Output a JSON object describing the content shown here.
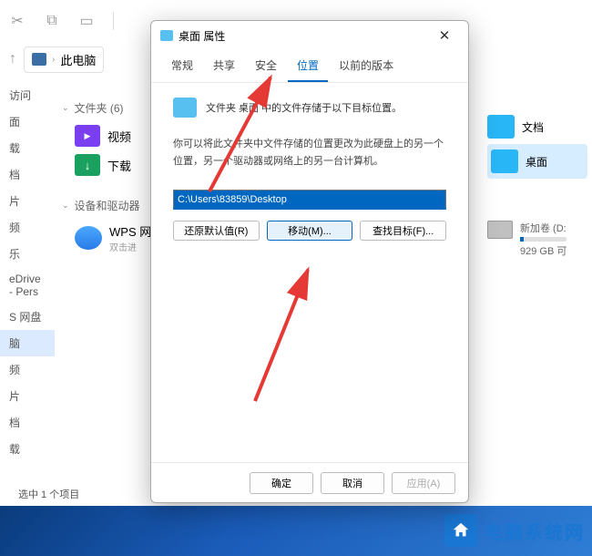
{
  "explorer": {
    "address_label": "此电脑",
    "sidebar_items": [
      "访问",
      "面",
      "载",
      "档",
      "片",
      "频",
      "乐",
      "eDrive - Pers",
      "S 网盘",
      "脑",
      "频",
      "片",
      "档",
      "载"
    ],
    "section_folders": "文件夹 (6)",
    "folder1": "视频",
    "folder2": "下载",
    "section_devices": "设备和驱动器",
    "device1": "WPS 网",
    "device1_sub": "双击进",
    "right_item1": "文档",
    "right_item2": "桌面",
    "drive_label": "新加卷 (D:",
    "drive_free": "929 GB 可",
    "status": "选中 1 个项目"
  },
  "dialog": {
    "title": "桌面 属性",
    "tabs": [
      "常规",
      "共享",
      "安全",
      "位置",
      "以前的版本"
    ],
    "active_tab_index": 3,
    "desc1": "文件夹 桌面 中的文件存储于以下目标位置。",
    "desc2": "你可以将此文件夹中文件存储的位置更改为此硬盘上的另一个位置，另一个驱动器或网络上的另一台计算机。",
    "path": "C:\\Users\\83859\\Desktop",
    "btn_restore": "还原默认值(R)",
    "btn_move": "移动(M)...",
    "btn_find": "查找目标(F)...",
    "btn_ok": "确定",
    "btn_cancel": "取消",
    "btn_apply": "应用(A)"
  },
  "watermark": "电脑系统网"
}
